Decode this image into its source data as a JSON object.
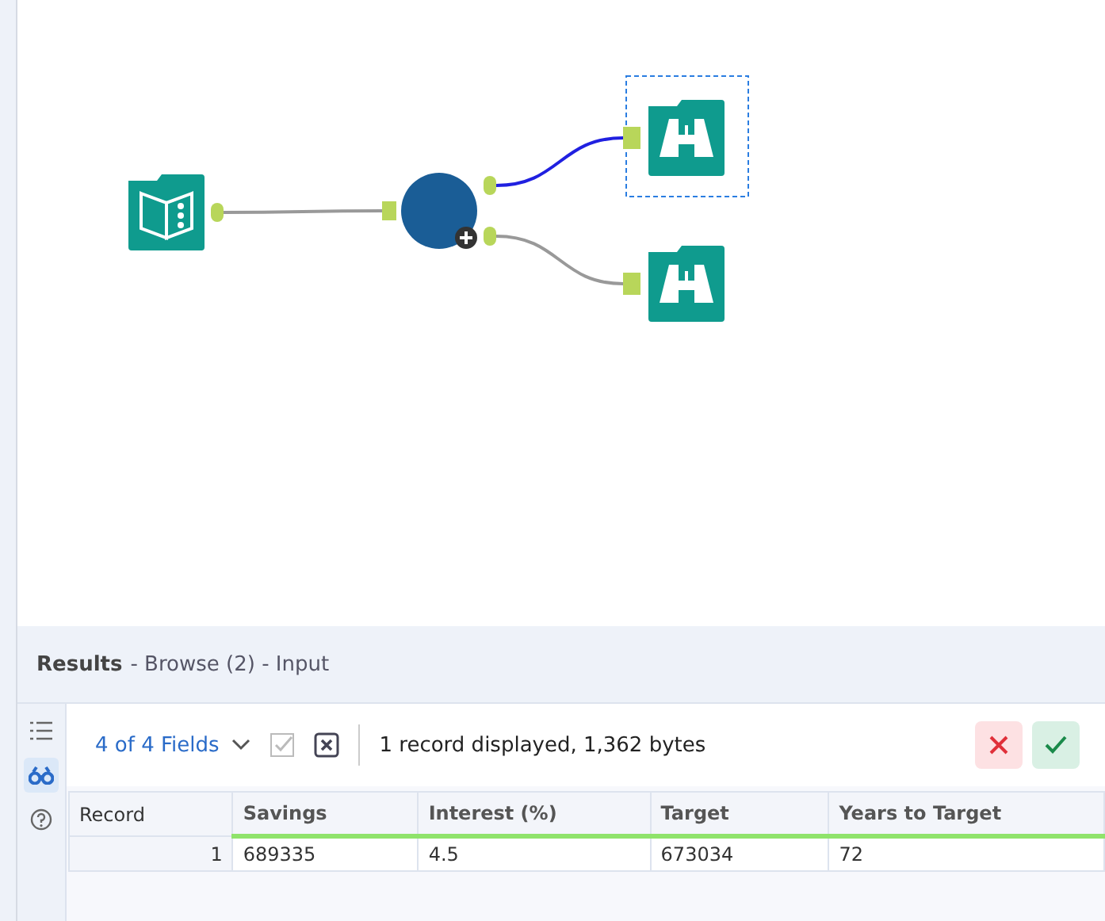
{
  "canvas": {
    "nodes": [
      {
        "kind": "input",
        "selected": false
      },
      {
        "kind": "formula",
        "selected": false
      },
      {
        "kind": "browse",
        "selected": true
      },
      {
        "kind": "browse",
        "selected": false
      }
    ],
    "connections": [
      {
        "selected": false
      },
      {
        "selected": true
      },
      {
        "selected": false
      }
    ]
  },
  "results": {
    "title": "Results",
    "subtitle": "- Browse (2) - Input",
    "side_tabs": [
      {
        "kind": "list",
        "selected": false
      },
      {
        "kind": "browse",
        "selected": true
      },
      {
        "kind": "help",
        "selected": false
      }
    ],
    "fields": "4 of 4 Fields",
    "summary": "1 record displayed, 1,362 bytes",
    "table": {
      "columns": [
        "Record",
        "Savings",
        "Interest (%)",
        "Target",
        "Years to Target"
      ],
      "rows": [
        [
          "1",
          "689335",
          "4.5",
          "673034",
          "72"
        ]
      ]
    }
  }
}
